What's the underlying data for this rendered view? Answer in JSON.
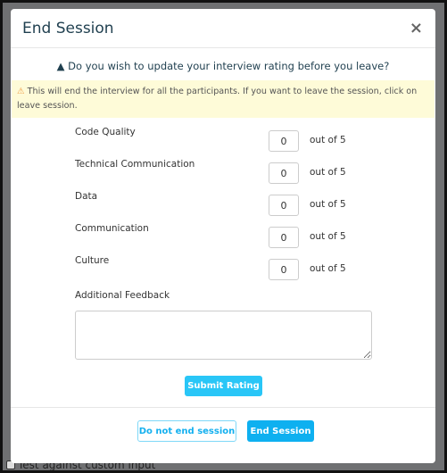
{
  "background": {
    "checkbox_label": "Test against custom input"
  },
  "modal": {
    "title": "End Session",
    "close_icon": "×",
    "question": "Do you wish to update your interview rating before you leave?",
    "alert": "This will end the interview for all the participants. If you want to leave the session, click on leave session.",
    "ratings": [
      {
        "label": "Code Quality",
        "value": "0",
        "suffix": "out of 5"
      },
      {
        "label": "Technical Communication",
        "value": "0",
        "suffix": "out of 5"
      },
      {
        "label": "Data",
        "value": "0",
        "suffix": "out of 5"
      },
      {
        "label": "Communication",
        "value": "0",
        "suffix": "out of 5"
      },
      {
        "label": "Culture",
        "value": "0",
        "suffix": "out of 5"
      }
    ],
    "feedback_label": "Additional Feedback",
    "feedback_value": "",
    "submit_label": "Submit Rating",
    "cancel_label": "Do not end session",
    "end_label": "End Session"
  },
  "colors": {
    "primary": "#0eb0f0",
    "submit": "#29c6f7",
    "alert_bg": "#fefbd8",
    "warning": "#f0a04b"
  }
}
